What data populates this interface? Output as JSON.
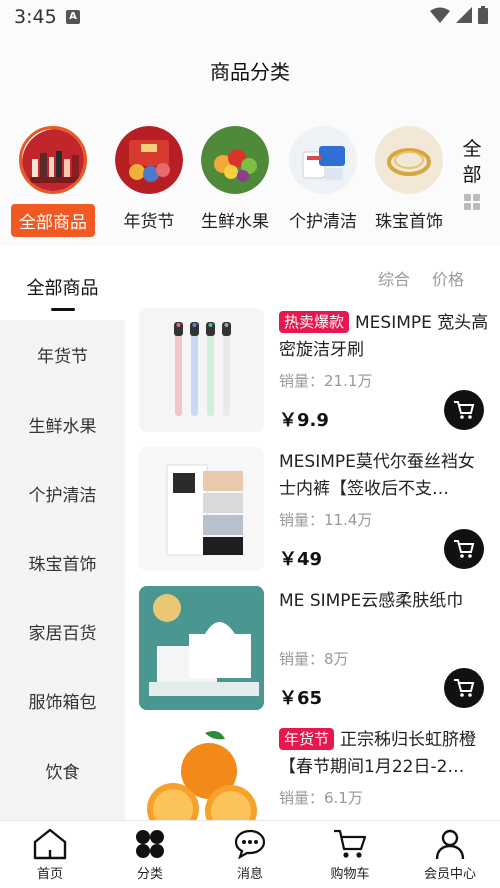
{
  "status": {
    "time": "3:45"
  },
  "header": {
    "title": "商品分类"
  },
  "categories": [
    {
      "label": "全部商品",
      "icon": "all-products-thumb",
      "active": true
    },
    {
      "label": "年货节",
      "icon": "new-year-goods-thumb"
    },
    {
      "label": "生鲜水果",
      "icon": "fresh-fruit-thumb"
    },
    {
      "label": "个护清洁",
      "icon": "personal-care-thumb"
    },
    {
      "label": "珠宝首饰",
      "icon": "jewelry-thumb"
    }
  ],
  "category_all": {
    "line1": "全",
    "line2": "部"
  },
  "sidebar": {
    "items": [
      {
        "label": "全部商品"
      },
      {
        "label": "年货节"
      },
      {
        "label": "生鲜水果"
      },
      {
        "label": "个护清洁"
      },
      {
        "label": "珠宝首饰"
      },
      {
        "label": "家居百货"
      },
      {
        "label": "服饰箱包"
      },
      {
        "label": "饮食"
      }
    ]
  },
  "sort": {
    "general": "综合",
    "price": "价格"
  },
  "products": [
    {
      "tag": "热卖爆款",
      "title": "MESIMPE 宽头高密旋洁牙刷",
      "sales": "销量：21.1万",
      "price": "￥9.9"
    },
    {
      "tag": "",
      "title": "MESIMPE莫代尔蚕丝裆女士内裤【签收后不支…",
      "sales": "销量：11.4万",
      "price": "￥49"
    },
    {
      "tag": "",
      "title": "ME SIMPE云感柔肤纸巾",
      "sales": "销量：8万",
      "price": "￥65"
    },
    {
      "tag": "年货节",
      "title": "正宗秭归长虹脐橙【春节期间1月22日-2…",
      "sales": "销量：6.1万",
      "price": ""
    }
  ],
  "nav": [
    {
      "label": "首页",
      "icon": "home-icon"
    },
    {
      "label": "分类",
      "icon": "category-icon"
    },
    {
      "label": "消息",
      "icon": "message-icon"
    },
    {
      "label": "购物车",
      "icon": "cart-icon"
    },
    {
      "label": "会员中心",
      "icon": "user-icon"
    }
  ],
  "colors": {
    "accent": "#f05a22",
    "tag_red": "#e8174d",
    "sidebar_bg": "#f4f4f4"
  }
}
